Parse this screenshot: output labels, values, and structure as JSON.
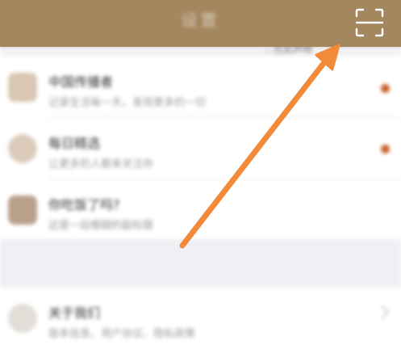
{
  "header": {
    "title": "设置",
    "scan_icon": "scan-icon",
    "background": "#a4875f"
  },
  "top_strip": {
    "text": "...在此声明"
  },
  "items": [
    {
      "title": "中国传播者",
      "subtitle": "记录生活每一天，发现更多的一切",
      "avatar_icon": "gift-box-icon",
      "has_dot": true
    },
    {
      "title": "每日精选",
      "subtitle": "让更多的人都来关注你",
      "avatar_icon": "profile-icon",
      "has_dot": true
    },
    {
      "title": "你吃饭了吗?",
      "subtitle": "这是一段模糊的副标题",
      "avatar_icon": "image-icon",
      "has_dot": false
    },
    {
      "title": "关于我们",
      "subtitle": "版本信息、用户协议、隐私政策",
      "avatar_icon": "info-icon",
      "has_chevron": true
    }
  ],
  "accent_color": "#c8612b",
  "arrow_color": "#f28a3a"
}
